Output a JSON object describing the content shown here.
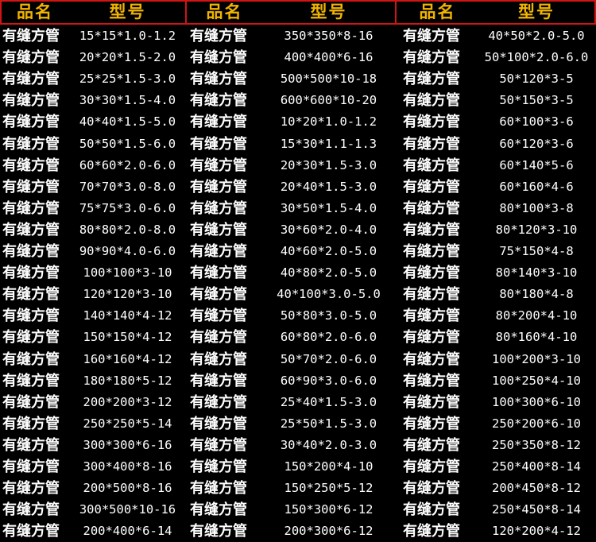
{
  "headers": [
    {
      "name": "品名",
      "spec": "型号"
    },
    {
      "name": "品名",
      "spec": "型号"
    },
    {
      "name": "品名",
      "spec": "型号"
    }
  ],
  "product_name": "有缝方管",
  "rows": [
    [
      "15*15*1.0-1.2",
      "350*350*8-16",
      "40*50*2.0-5.0"
    ],
    [
      "20*20*1.5-2.0",
      "400*400*6-16",
      "50*100*2.0-6.0"
    ],
    [
      "25*25*1.5-3.0",
      "500*500*10-18",
      "50*120*3-5"
    ],
    [
      "30*30*1.5-4.0",
      "600*600*10-20",
      "50*150*3-5"
    ],
    [
      "40*40*1.5-5.0",
      "10*20*1.0-1.2",
      "60*100*3-6"
    ],
    [
      "50*50*1.5-6.0",
      "15*30*1.1-1.3",
      "60*120*3-6"
    ],
    [
      "60*60*2.0-6.0",
      "20*30*1.5-3.0",
      "60*140*5-6"
    ],
    [
      "70*70*3.0-8.0",
      "20*40*1.5-3.0",
      "60*160*4-6"
    ],
    [
      "75*75*3.0-6.0",
      "30*50*1.5-4.0",
      "80*100*3-8"
    ],
    [
      "80*80*2.0-8.0",
      "30*60*2.0-4.0",
      "80*120*3-10"
    ],
    [
      "90*90*4.0-6.0",
      "40*60*2.0-5.0",
      "75*150*4-8"
    ],
    [
      "100*100*3-10",
      "40*80*2.0-5.0",
      "80*140*3-10"
    ],
    [
      "120*120*3-10",
      "40*100*3.0-5.0",
      "80*180*4-8"
    ],
    [
      "140*140*4-12",
      "50*80*3.0-5.0",
      "80*200*4-10"
    ],
    [
      "150*150*4-12",
      "60*80*2.0-6.0",
      "80*160*4-10"
    ],
    [
      "160*160*4-12",
      "50*70*2.0-6.0",
      "100*200*3-10"
    ],
    [
      "180*180*5-12",
      "60*90*3.0-6.0",
      "100*250*4-10"
    ],
    [
      "200*200*3-12",
      "25*40*1.5-3.0",
      "100*300*6-10"
    ],
    [
      "250*250*5-14",
      "25*50*1.5-3.0",
      "250*200*6-10"
    ],
    [
      "300*300*6-16",
      "30*40*2.0-3.0",
      "250*350*8-12"
    ],
    [
      "300*400*8-16",
      "150*200*4-10",
      "250*400*8-14"
    ],
    [
      "200*500*8-16",
      "150*250*5-12",
      "200*450*8-12"
    ],
    [
      "300*500*10-16",
      "150*300*6-12",
      "250*450*8-14"
    ],
    [
      "200*400*6-14",
      "200*300*6-12",
      "120*200*4-12"
    ]
  ],
  "colors": {
    "background": "#000000",
    "grid": "#d11414",
    "header_text": "#f3b400",
    "body_text": "#ffffff"
  }
}
